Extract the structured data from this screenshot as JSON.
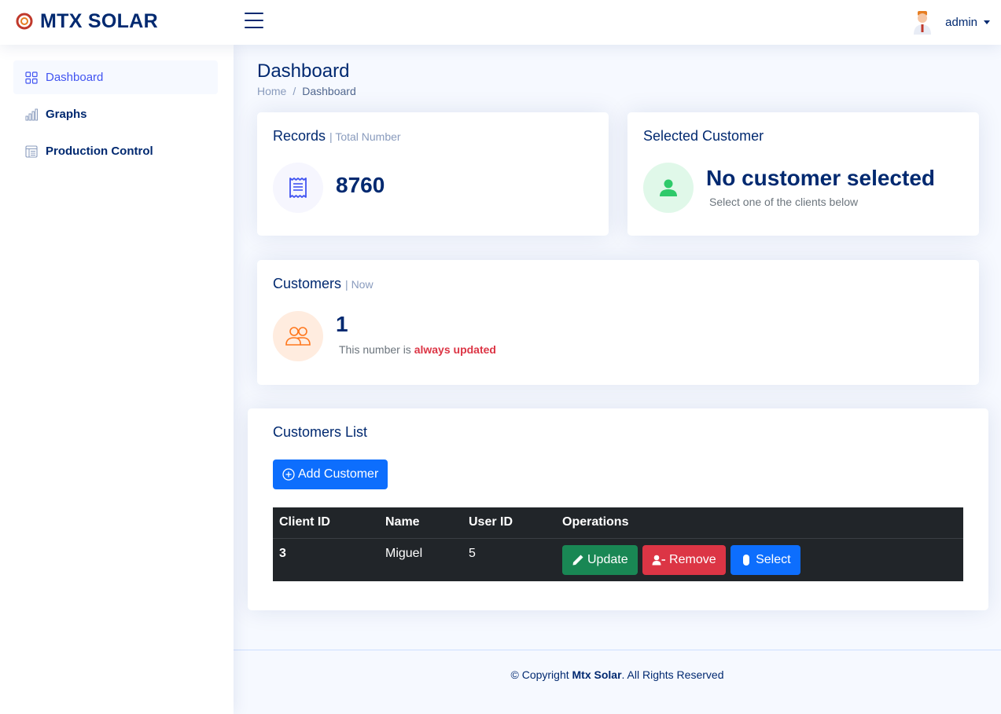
{
  "brand": {
    "name": "MTX SOLAR"
  },
  "user": {
    "name": "admin"
  },
  "sidebar": {
    "items": [
      {
        "label": "Dashboard",
        "icon": "grid-icon",
        "active": true
      },
      {
        "label": "Graphs",
        "icon": "bar-chart-icon",
        "active": false
      },
      {
        "label": "Production Control",
        "icon": "layout-text-window-icon",
        "active": false
      }
    ]
  },
  "page": {
    "title": "Dashboard",
    "breadcrumb": {
      "home": "Home",
      "separator": "/",
      "current": "Dashboard"
    }
  },
  "records_card": {
    "title": "Records",
    "subtitle": "| Total Number",
    "value": "8760",
    "icon": "receipt-icon"
  },
  "selected_customer_card": {
    "title": "Selected Customer",
    "headline": "No customer selected",
    "hint": "Select one of the clients below",
    "icon": "person-icon"
  },
  "customers_card": {
    "title": "Customers",
    "subtitle": "| Now",
    "value": "1",
    "note_prefix": "This number is ",
    "note_highlight": "always updated",
    "icon": "people-icon"
  },
  "customers_list": {
    "title": "Customers List",
    "add_button": "Add Customer",
    "columns": [
      "Client ID",
      "Name",
      "User ID",
      "Operations"
    ],
    "rows": [
      {
        "client_id": "3",
        "name": "Miguel",
        "user_id": "5"
      }
    ],
    "operations": {
      "update": "Update",
      "remove": "Remove",
      "select": "Select"
    }
  },
  "footer": {
    "prefix": "© Copyright ",
    "brand": "Mtx Solar",
    "suffix": ". All Rights Reserved"
  },
  "colors": {
    "primary_text": "#012970",
    "accent": "#4154f1",
    "muted": "#899bbd",
    "success": "#198754",
    "danger": "#dc3545",
    "primary_button": "#0d6efd",
    "highlight_red": "#dc3545"
  }
}
